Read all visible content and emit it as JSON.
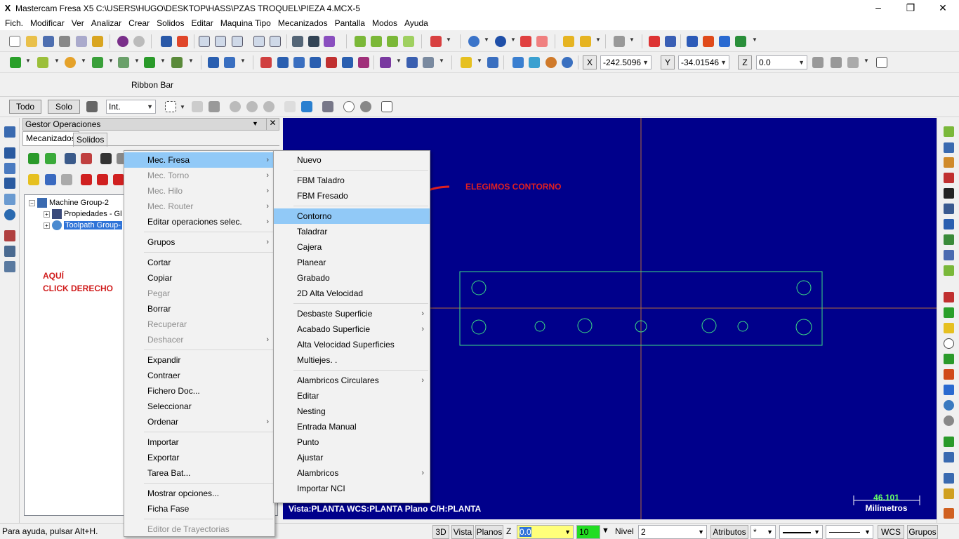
{
  "window": {
    "title": "Mastercam Fresa X5  C:\\USERS\\HUGO\\DESKTOP\\HASS\\PZAS TROQUEL\\PIEZA 4.MCX-5",
    "controls": [
      "–",
      "❐",
      "✕"
    ]
  },
  "menubar": [
    "Fich.",
    "Modificar",
    "Ver",
    "Analizar",
    "Crear",
    "Solidos",
    "Editar",
    "Maquina Tipo",
    "Mecanizados",
    "Pantalla",
    "Modos",
    "Ayuda"
  ],
  "coords": {
    "x_label": "X",
    "x_value": "-242.5096",
    "y_label": "Y",
    "y_value": "-34.01546",
    "z_label": "Z",
    "z_value": "0.0"
  },
  "ribbon_bar": {
    "label": "Ribbon Bar"
  },
  "selection_bar": {
    "todo": "Todo",
    "solo": "Solo",
    "mode": "Int."
  },
  "op_manager": {
    "title": "Gestor Operaciones",
    "close": "✕",
    "tabs": [
      "Mecanizados",
      "Solidos"
    ],
    "tree": {
      "machine_group": "Machine Group-2",
      "properties": "Propiedades - Gl",
      "toolpath_group": "Toolpath Group-"
    }
  },
  "annotations": {
    "aqui_line1": "AQUÍ",
    "aqui_line2": "CLICK DERECHO",
    "contorno": "ELEGIMOS CONTORNO"
  },
  "context_menu": {
    "items": [
      {
        "label": "Mec. Fresa",
        "submenu": true,
        "highlighted": true
      },
      {
        "label": "Mec. Torno",
        "submenu": true,
        "disabled": true
      },
      {
        "label": "Mec. Hilo",
        "submenu": true,
        "disabled": true
      },
      {
        "label": "Mec. Router",
        "submenu": true,
        "disabled": true
      },
      {
        "label": "Editar operaciones selec.",
        "submenu": true
      },
      {
        "label": "Grupos",
        "submenu": true
      },
      {
        "label": "Cortar"
      },
      {
        "label": "Copiar"
      },
      {
        "label": "Pegar",
        "disabled": true
      },
      {
        "label": "Borrar"
      },
      {
        "label": "Recuperar",
        "disabled": true
      },
      {
        "label": "Deshacer",
        "submenu": true,
        "disabled": true
      },
      {
        "label": "Expandir"
      },
      {
        "label": "Contraer"
      },
      {
        "label": "Fichero Doc..."
      },
      {
        "label": "Seleccionar"
      },
      {
        "label": "Ordenar",
        "submenu": true
      },
      {
        "label": "Importar"
      },
      {
        "label": "Exportar"
      },
      {
        "label": "Tarea Bat..."
      },
      {
        "label": "Mostrar opciones..."
      },
      {
        "label": "Ficha Fase"
      },
      {
        "label": "Editor de Trayectorias",
        "disabled": true
      }
    ]
  },
  "submenu": {
    "items": [
      {
        "label": "Nuevo"
      },
      {
        "label": "FBM Taladro"
      },
      {
        "label": "FBM Fresado"
      },
      {
        "label": "Contorno",
        "highlighted": true
      },
      {
        "label": "Taladrar"
      },
      {
        "label": "Cajera"
      },
      {
        "label": "Planear"
      },
      {
        "label": "Grabado"
      },
      {
        "label": "2D Alta Velocidad"
      },
      {
        "label": "Desbaste Superficie",
        "submenu": true
      },
      {
        "label": "Acabado Superficie",
        "submenu": true
      },
      {
        "label": "Alta Velocidad Superficies"
      },
      {
        "label": "Multiejes. ."
      },
      {
        "label": "Alambricos Circulares",
        "submenu": true
      },
      {
        "label": "Editar"
      },
      {
        "label": "Nesting"
      },
      {
        "label": "Entrada Manual"
      },
      {
        "label": "Punto"
      },
      {
        "label": "Ajustar"
      },
      {
        "label": "Alambricos",
        "submenu": true
      },
      {
        "label": "Importar NCI"
      }
    ]
  },
  "viewport": {
    "status": "Vista:PLANTA    WCS:PLANTA    Plano C/H:PLANTA",
    "scale_value": "46.101",
    "scale_unit": "Milímetros"
  },
  "statusbar": {
    "help": "Para ayuda, pulsar Alt+H.",
    "btn_3d": "3D",
    "btn_vista": "Vista",
    "btn_planos": "Planos",
    "z_label": "Z",
    "z_value": "0.0",
    "color_value": "10",
    "nivel_label": "Nivel",
    "nivel_value": "2",
    "atributos": "Atributos",
    "wcs": "WCS",
    "grupos": "Grupos"
  },
  "colors": {
    "viewport_bg": "#00008b",
    "geometry": "#3ddc84",
    "axis": "#b36b3a",
    "highlight": "#91c9f7",
    "annotation_red": "#d01c1c"
  }
}
